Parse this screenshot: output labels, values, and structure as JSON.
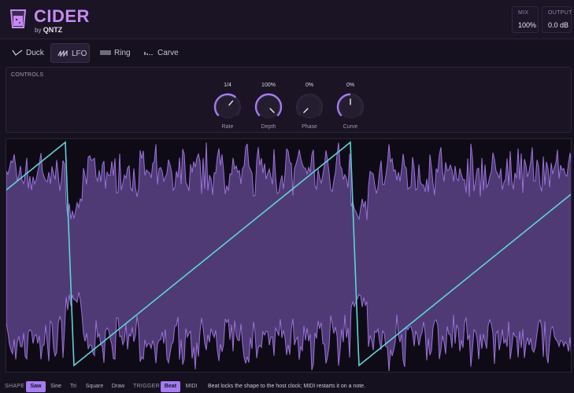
{
  "header": {
    "title": "CIDER",
    "by_prefix": "by",
    "by_brand": "QNTZ",
    "mix": {
      "label": "MIX",
      "value": "100%"
    },
    "output": {
      "label": "OUTPUT",
      "value": "0.0 dB"
    }
  },
  "tabs": [
    {
      "label": "Duck",
      "icon": "duck-curve-icon",
      "active": false
    },
    {
      "label": "LFO",
      "icon": "lfo-wave-icon",
      "active": true
    },
    {
      "label": "Ring",
      "icon": "ring-wave-icon",
      "active": false
    },
    {
      "label": "Carve",
      "icon": "carve-bars-icon",
      "active": false
    }
  ],
  "controls": {
    "label": "CONTROLS",
    "knobs": [
      {
        "name": "Rate",
        "value": "1/4",
        "level": 0.65
      },
      {
        "name": "Depth",
        "value": "100%",
        "level": 1.0
      },
      {
        "name": "Phase",
        "value": "0%",
        "level": 0.0
      },
      {
        "name": "Curve",
        "value": "0%",
        "level": 0.5
      }
    ]
  },
  "footer": {
    "shape_label": "SHAPE",
    "shapes": [
      "Saw",
      "Sine",
      "Tri",
      "Square",
      "Draw"
    ],
    "shape_selected": "Saw",
    "trigger_label": "TRIGGER",
    "triggers": [
      "Beat",
      "MIDI"
    ],
    "trigger_selected": "Beat",
    "hint": "Beat locks the shape to the host clock; MIDI restarts it on a note."
  },
  "colors": {
    "accent": "#a47cf0",
    "brand": "#c58af0",
    "lfo_line": "#5fd3d6",
    "waveform_fill": "#4f3a76",
    "waveform_line": "#9a72d8"
  }
}
